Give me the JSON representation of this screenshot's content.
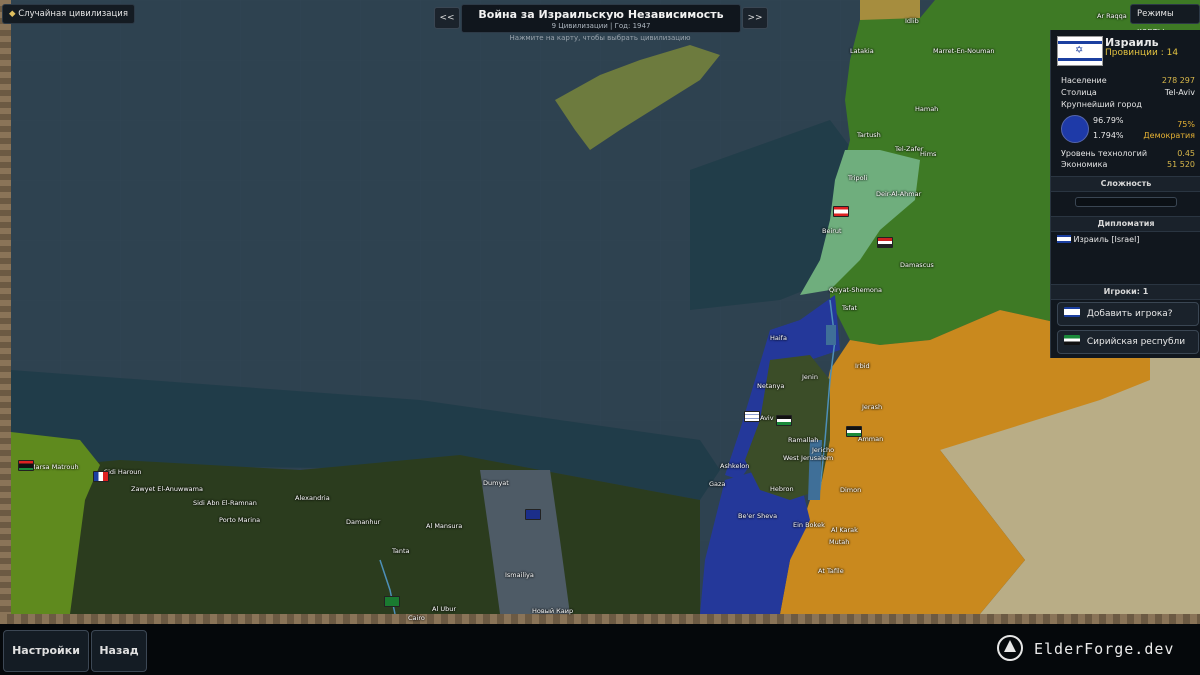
{
  "header": {
    "random_civ_label": "Случайная цивилизация",
    "map_modes_label": "Режимы карты",
    "prev_label": "<<",
    "next_label": ">>",
    "title": "Война за Израильскую Независимость",
    "subtitle": "9 Цивилизации | Год: 1947",
    "hint": "Нажмите на карту, чтобы выбрать цивилизацию"
  },
  "panel": {
    "country_name": "Израиль",
    "provinces_label": "Провинции : 14",
    "population_label": "Население",
    "population_value": "278 297",
    "capital_label": "Столица",
    "capital_value": "Tel-Aviv",
    "largest_city_label": "Крупнейший город",
    "stat_a": "96.79%",
    "stat_b": "1.794%",
    "stat_c": "75%",
    "government": "Демократия",
    "tech_label": "Уровень технологий",
    "tech_value": "0.45",
    "economy_label": "Экономика",
    "economy_value": "51 520",
    "difficulty_section": "Сложность",
    "diplomacy_section": "Дипломатия",
    "diplomacy_item": "Израиль [Israel]",
    "players_section": "Игроки: 1",
    "add_player": "Добавить игрока?",
    "syria_player": "Сирийская республи"
  },
  "footer": {
    "settings": "Настройки",
    "back": "Назад",
    "brand": "ElderForge.dev"
  },
  "colors": {
    "sea": "#2e4250",
    "deep_sea": "#1f3c48",
    "israel": "#24389a",
    "syria": "#3e7a25",
    "lebanon": "#6fae7d",
    "jordan": "#c9891e",
    "egypt": "#2b3c1e",
    "palestine": "#3b4d28",
    "libya": "#5f8a1e",
    "desert": "#b9ad86"
  },
  "cities": [
    "Idlib",
    "Ar Raqqa",
    "Latakia",
    "Marret-En-Nouman",
    "Hamah",
    "Tartush",
    "Tel-Zafer",
    "Hims",
    "Tripoli",
    "Deir-Al-Ahmar",
    "Beirut",
    "Damascus",
    "Qiryat-Shemona",
    "Tsfat",
    "Haifa",
    "Jenin",
    "Irbid",
    "Netanya",
    "Aviv",
    "Jerash",
    "Ramallah",
    "Amman",
    "Jericho",
    "West Jerusalem",
    "Ashkelon",
    "Gaza",
    "Hebron",
    "Dimon",
    "Be'er Sheva",
    "Ein Bokek",
    "Al Karak",
    "Mutah",
    "At Tafile",
    "Marsa Matrouh",
    "Sidi Haroun",
    "Zawyet El-Anuwwama",
    "Sidi Abn El-Ramnan",
    "Alexandria",
    "Porto Marina",
    "Damanhur",
    "Al Mansura",
    "Dumyat",
    "Tanta",
    "Ismailiya",
    "Al Ubur",
    "Cairo",
    "Новый Каир"
  ],
  "icons": [
    "random-civ-icon",
    "map-modes-icon",
    "israel-flag-icon",
    "settings-gear-icon",
    "elderforge-logo-icon"
  ]
}
